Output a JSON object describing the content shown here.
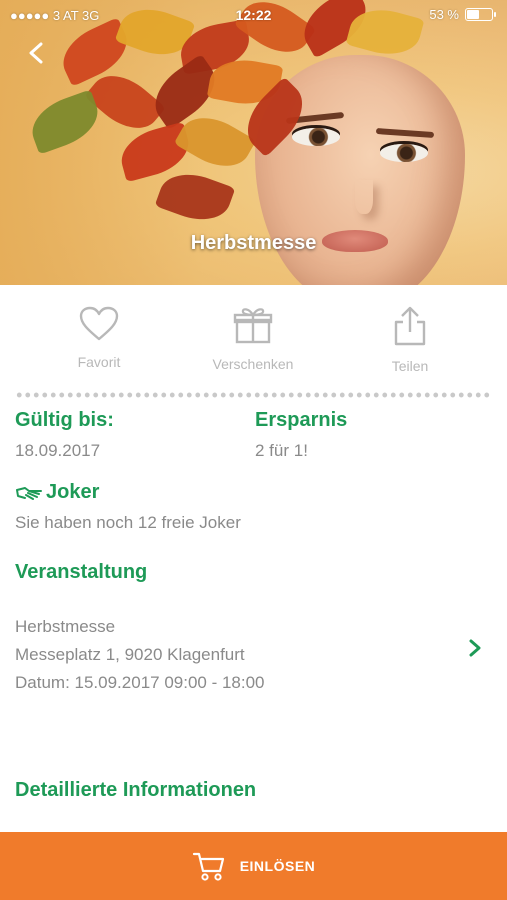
{
  "status_bar": {
    "carrier": "●●●●● 3 AT  3G",
    "time": "12:22",
    "battery": "53 %",
    "battery_level": 0.53
  },
  "hero": {
    "title": "Herbstmesse"
  },
  "actions": [
    {
      "label": "Favorit",
      "icon": "heart-icon"
    },
    {
      "label": "Verschenken",
      "icon": "gift-icon"
    },
    {
      "label": "Teilen",
      "icon": "share-icon"
    }
  ],
  "valid": {
    "heading": "Gültig bis:",
    "value": "18.09.2017"
  },
  "savings": {
    "heading": "Ersparnis",
    "value": "2 für 1!"
  },
  "joker": {
    "heading": "Joker",
    "text": "Sie haben noch 12 freie Joker",
    "icon": "joker-hand-icon"
  },
  "event": {
    "heading": "Veranstaltung",
    "name": "Herbstmesse",
    "address": "Messeplatz 1, 9020 Klagenfurt",
    "date": "Datum: 15.09.2017 09:00 - 18:00"
  },
  "details": {
    "heading": "Detaillierte Informationen"
  },
  "footer": {
    "label": "EINLÖSEN",
    "icon": "cart-icon"
  },
  "colors": {
    "accent_green": "#1e9a57",
    "cta_orange": "#f07b2b",
    "muted": "#8a8a8a"
  }
}
